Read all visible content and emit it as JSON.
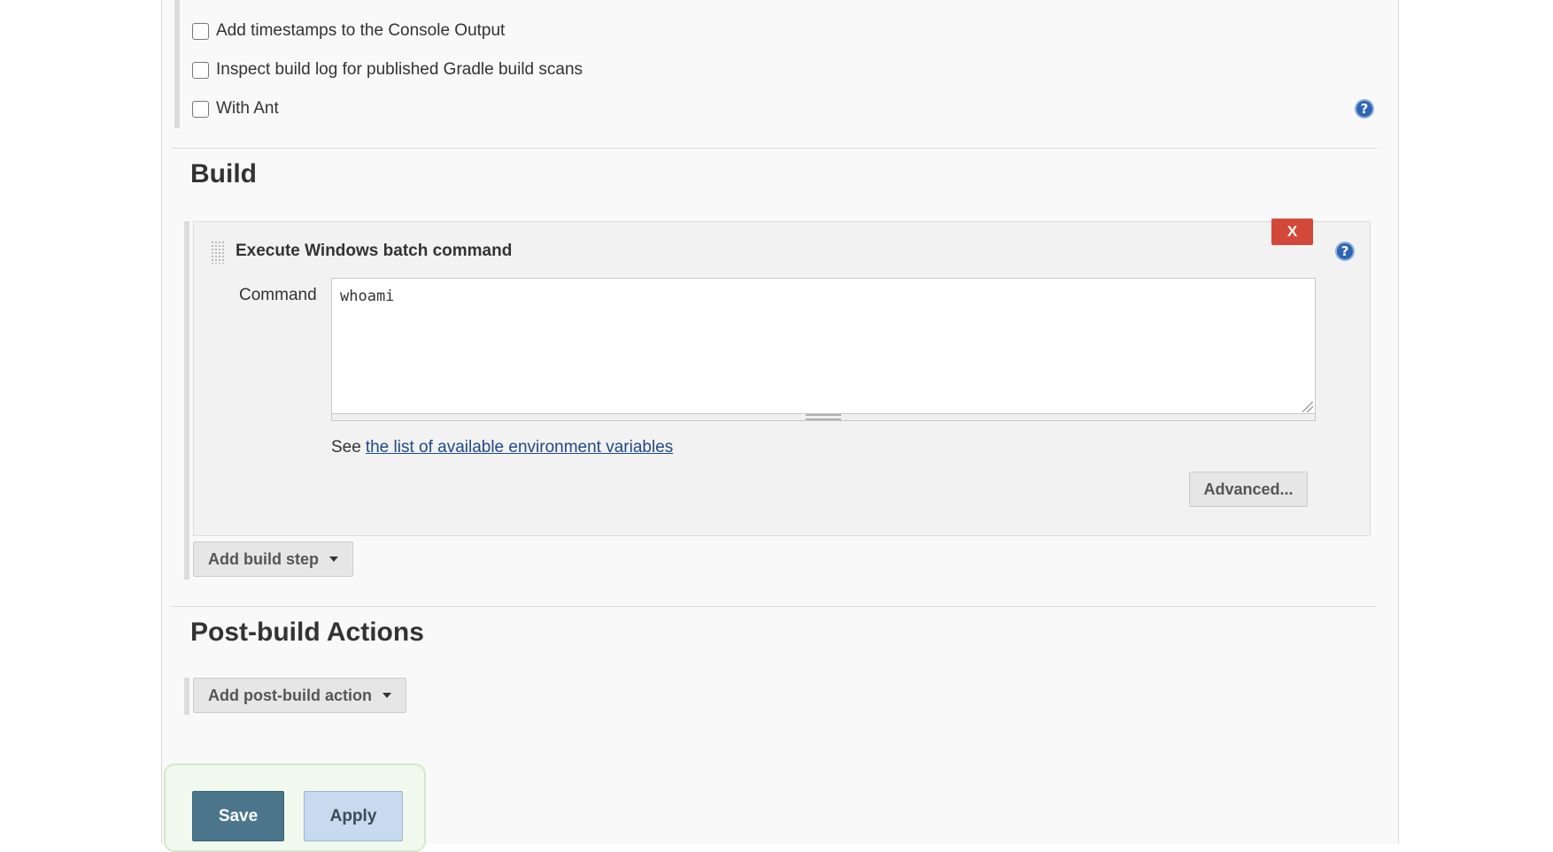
{
  "options": [
    {
      "label": "Add timestamps to the Console Output",
      "checked": false
    },
    {
      "label": "Inspect build log for published Gradle build scans",
      "checked": false
    },
    {
      "label": "With Ant",
      "checked": false
    }
  ],
  "help_icon": "?",
  "build": {
    "title": "Build",
    "step": {
      "title": "Execute Windows batch command",
      "delete_label": "X",
      "command_label": "Command",
      "command_value": "whoami",
      "env_prefix": "See",
      "env_link": "the list of available environment variables",
      "advanced_label": "Advanced..."
    },
    "add_step_label": "Add build step"
  },
  "post_build": {
    "title": "Post-build Actions",
    "add_action_label": "Add post-build action"
  },
  "footer": {
    "save_label": "Save",
    "apply_label": "Apply"
  },
  "colors": {
    "delete": "#d24939",
    "save": "#4b758b",
    "apply": "#c8daef",
    "help": "#2e65b3",
    "link": "#204a87"
  }
}
